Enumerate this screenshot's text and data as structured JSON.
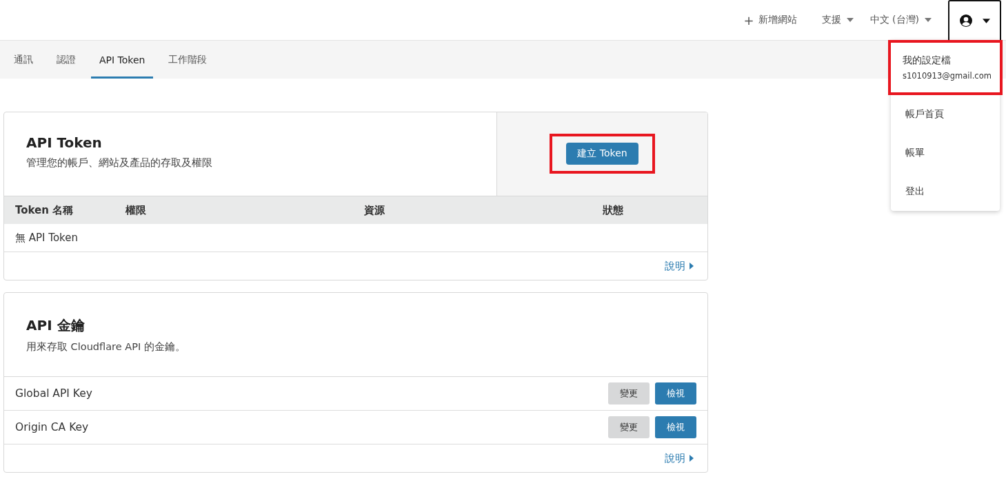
{
  "top_nav": {
    "add_site": {
      "icon": "+",
      "label": "新增網站"
    },
    "menus": [
      {
        "label": "支援"
      },
      {
        "label": "中文 (台灣)"
      }
    ],
    "user_menu": {
      "expanded": true
    }
  },
  "dropdown": {
    "items": [
      {
        "kind": "profile",
        "label": "我的設定檔",
        "email": "s1010913@gmail.com",
        "highlighted": true
      },
      {
        "kind": "link",
        "label": "帳戶首頁",
        "highlighted": false
      },
      {
        "kind": "link",
        "label": "帳單",
        "highlighted": false
      },
      {
        "kind": "link",
        "label": "登出",
        "highlighted": false
      }
    ]
  },
  "tabs": [
    {
      "label": "通訊",
      "selected": false
    },
    {
      "label": "認證",
      "selected": false
    },
    {
      "label": "API Token",
      "selected": true
    },
    {
      "label": "工作階段",
      "selected": false
    }
  ],
  "api_tokens": {
    "title": "API Token",
    "description": "管理您的帳戶、網站及產品的存取及權限",
    "create_button": {
      "label": "建立 Token",
      "highlighted": true
    },
    "columns": [
      "Token 名稱",
      "權限",
      "資源",
      "狀態"
    ],
    "empty_text": "無 API Token",
    "help_link": "說明"
  },
  "api_keys": {
    "title": "API 金鑰",
    "description": "用來存取 Cloudflare API 的金鑰。",
    "rows": [
      {
        "name": "Global API Key",
        "actions": [
          "變更",
          "檢視"
        ]
      },
      {
        "name": "Origin CA Key",
        "actions": [
          "變更",
          "檢視"
        ]
      }
    ],
    "help_link": "說明"
  }
}
